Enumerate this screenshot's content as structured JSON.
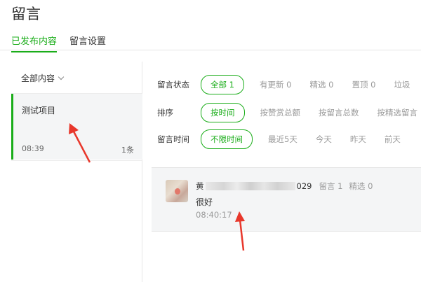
{
  "header": {
    "title": "留言"
  },
  "tabs": [
    {
      "label": "已发布内容",
      "active": true
    },
    {
      "label": "留言设置",
      "active": false
    }
  ],
  "sidebar": {
    "filter": "全部内容",
    "item": {
      "title": "测试项目",
      "time": "08:39",
      "count": "1条"
    }
  },
  "filters": {
    "status": {
      "label": "留言状态",
      "options": [
        "全部 1",
        "有更新 0",
        "精选 0",
        "置顶 0",
        "垃圾"
      ],
      "selected": 0
    },
    "sort": {
      "label": "排序",
      "options": [
        "按时间",
        "按赞赏总额",
        "按留言总数",
        "按精选留言"
      ],
      "selected": 0
    },
    "time": {
      "label": "留言时间",
      "options": [
        "不限时间",
        "最近5天",
        "今天",
        "昨天",
        "前天"
      ],
      "selected": 0
    }
  },
  "comment": {
    "name_prefix": "黄",
    "name_suffix": "029",
    "replies": "留言 1",
    "featured": "精选 0",
    "text": "很好",
    "time": "08:40:17"
  },
  "colors": {
    "accent": "#1aad19",
    "annotation": "#e8372b"
  }
}
